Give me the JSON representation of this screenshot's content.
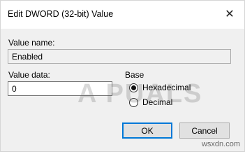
{
  "window": {
    "title": "Edit DWORD (32-bit) Value",
    "close_glyph": "✕"
  },
  "value_name": {
    "label": "Value name:",
    "value": "Enabled"
  },
  "value_data": {
    "label": "Value data:",
    "value": "0"
  },
  "base": {
    "label": "Base",
    "options": [
      {
        "label": "Hexadecimal",
        "selected": true
      },
      {
        "label": "Decimal",
        "selected": false
      }
    ]
  },
  "buttons": {
    "ok": "OK",
    "cancel": "Cancel"
  },
  "watermark": "A PUALS",
  "site_watermark": "wsxdn.com",
  "colors": {
    "accent": "#0078d7",
    "body_bg": "#f0f0f0"
  }
}
